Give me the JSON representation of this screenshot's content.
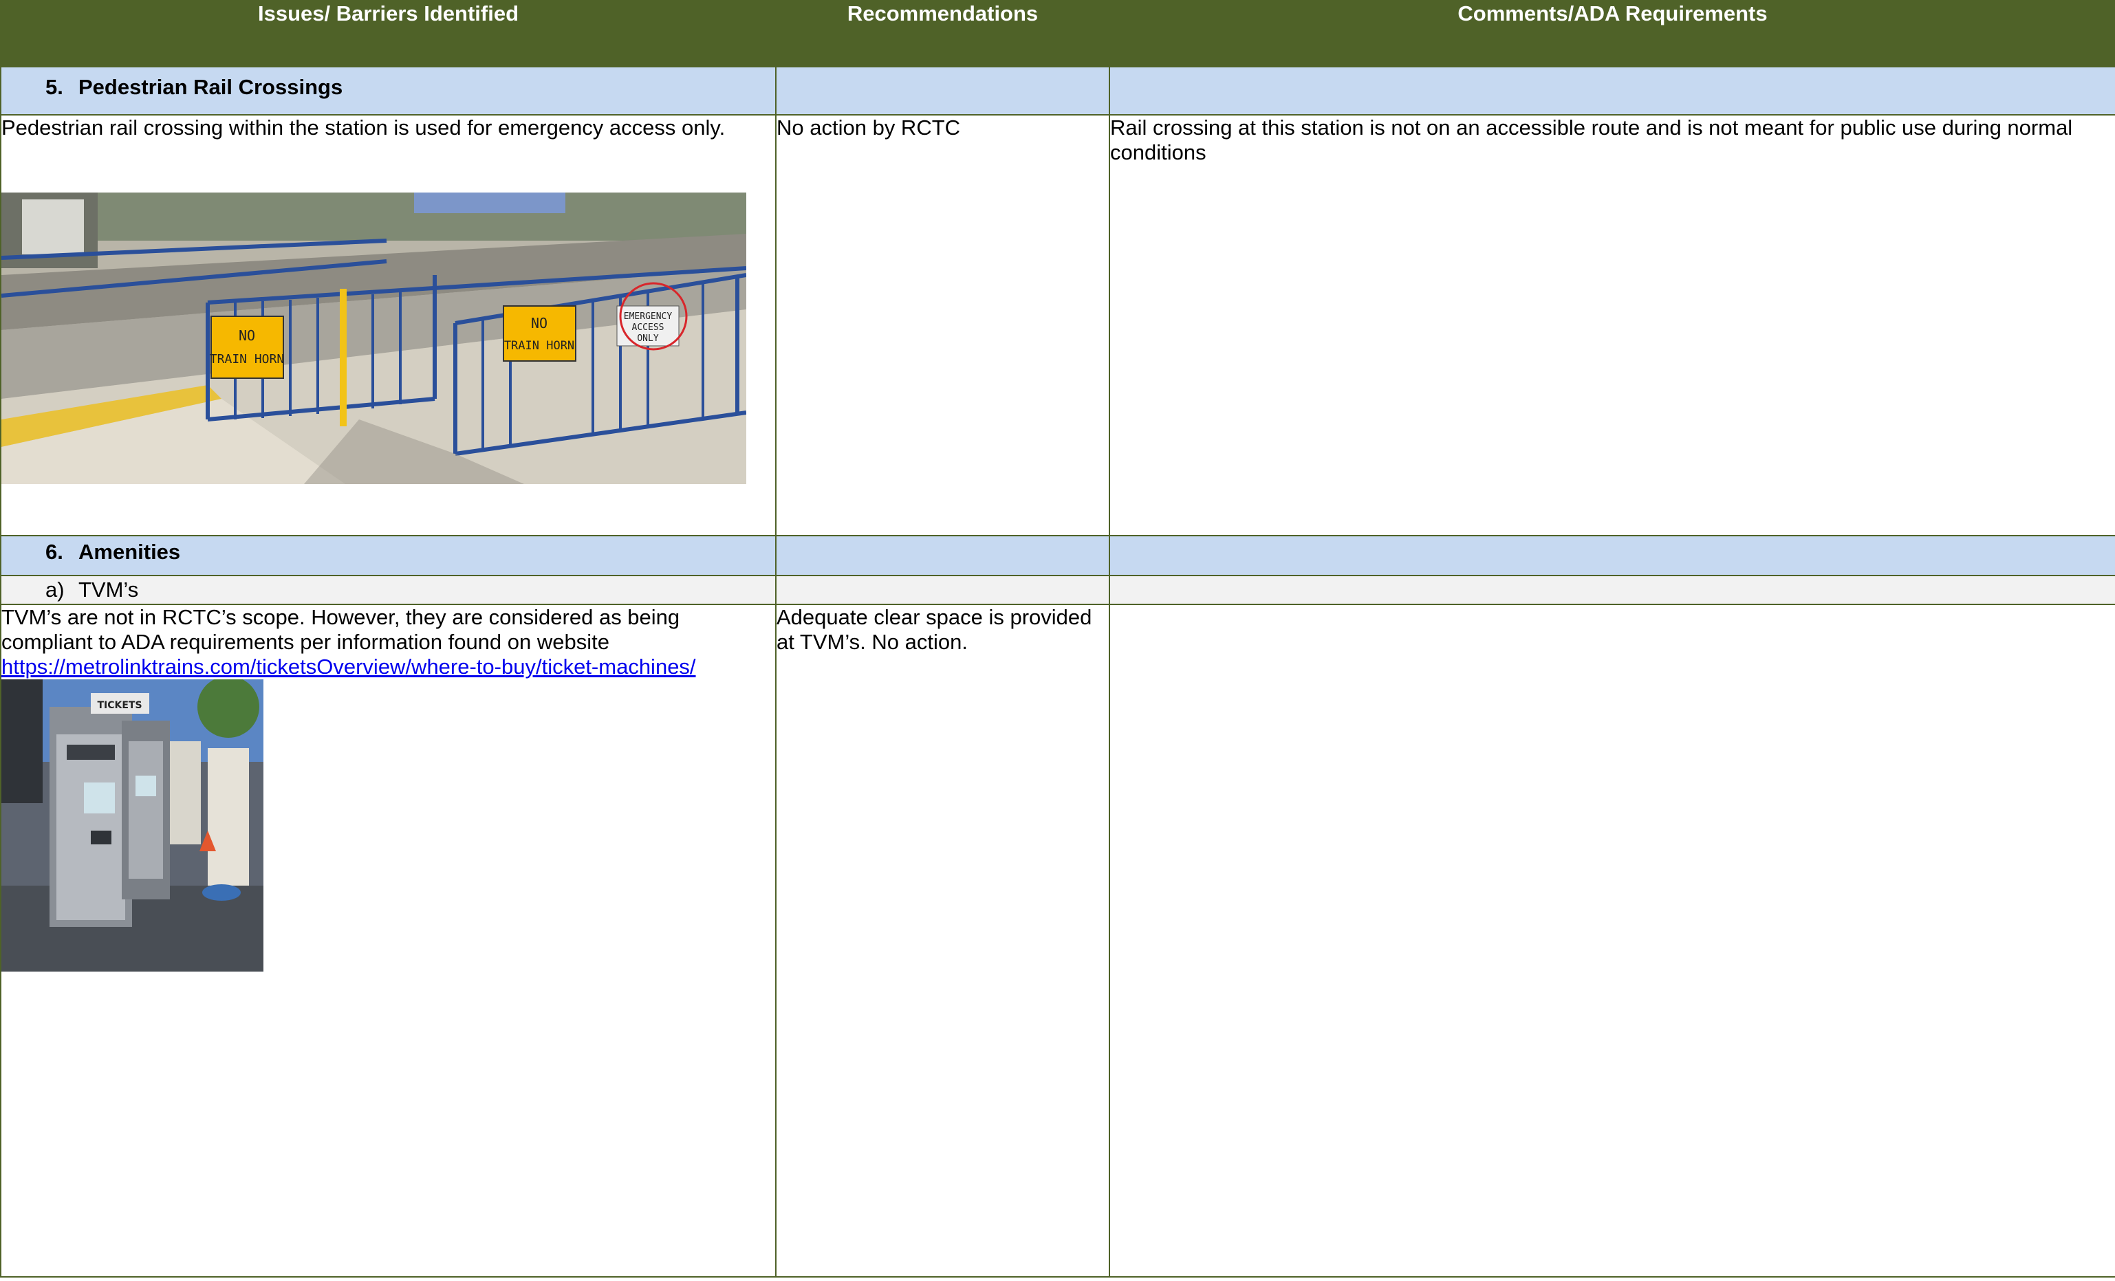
{
  "table": {
    "headers": [
      "Issues/ Barriers Identified",
      "Recommendations",
      "Comments/ADA Requirements"
    ]
  },
  "section5": {
    "number": "5.",
    "title": "Pedestrian Rail Crossings",
    "issue": "Pedestrian rail crossing within the station is used for emergency access only.",
    "recommendation": "No action by RCTC",
    "comment": "Rail crossing at this station is not on an accessible route and is not meant for public use during normal conditions",
    "photo": {
      "sign_left_line1": "NO",
      "sign_left_line2": "TRAIN HORN",
      "sign_right_line1": "NO",
      "sign_right_line2": "TRAIN HORN",
      "emergency_line1": "EMERGENCY",
      "emergency_line2": "ACCESS",
      "emergency_line3": "ONLY"
    }
  },
  "section6": {
    "number": "6.",
    "title": "Amenities",
    "sub": {
      "letter": "a)",
      "title": "TVM’s",
      "issue": "TVM’s are not in RCTC’s scope. However, they are considered as being compliant to ADA requirements per information found on website ",
      "link": "https://metrolinktrains.com/ticketsOverview/where-to-buy/ticket-machines/",
      "recommendation": "Adequate clear space is provided at TVM’s. No action.",
      "photo": {
        "sign": "TICKETS"
      }
    }
  },
  "colors": {
    "header_bg": "#4f6228",
    "section_bg": "#c6d9f1",
    "sub_bg": "#f2f2f2",
    "link": "#0000ee"
  }
}
